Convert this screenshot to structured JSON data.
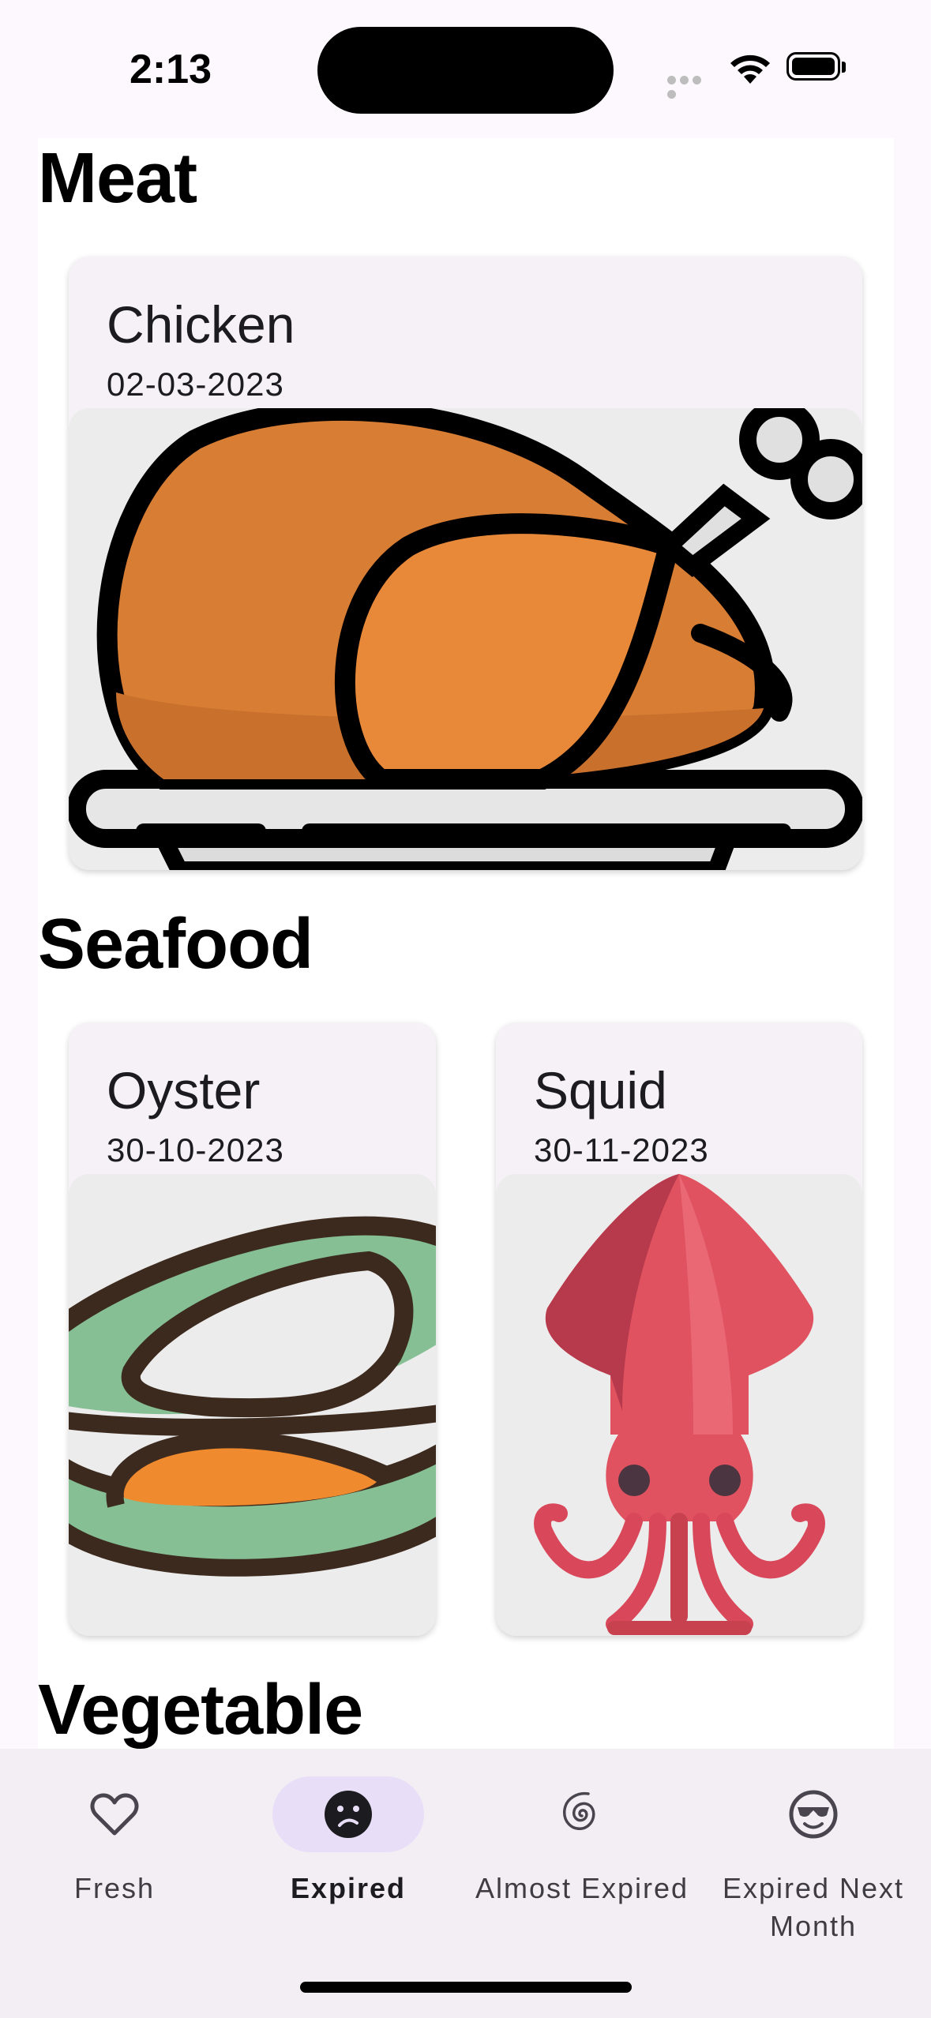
{
  "status_bar": {
    "time": "2:13"
  },
  "sections": [
    {
      "title": "Meat",
      "items": [
        {
          "name": "Chicken",
          "date": "02-03-2023",
          "icon": "roast-chicken-icon"
        }
      ]
    },
    {
      "title": "Seafood",
      "items": [
        {
          "name": "Oyster",
          "date": "30-10-2023",
          "icon": "oyster-icon"
        },
        {
          "name": "Squid",
          "date": "30-11-2023",
          "icon": "squid-icon"
        }
      ]
    },
    {
      "title": "Vegetable",
      "items": []
    }
  ],
  "bottom_nav": {
    "items": [
      {
        "label": "Fresh",
        "icon": "heart-outline-icon",
        "active": false
      },
      {
        "label": "Expired",
        "icon": "sad-face-icon",
        "active": true
      },
      {
        "label": "Almost Expired",
        "icon": "spiral-icon",
        "active": false
      },
      {
        "label": "Expired Next Month",
        "icon": "sunglasses-face-icon",
        "active": false
      }
    ]
  },
  "colors": {
    "nav_active_pill": "#e8def8",
    "card_bg": "#f5f1f6",
    "image_bg": "#ececec"
  }
}
